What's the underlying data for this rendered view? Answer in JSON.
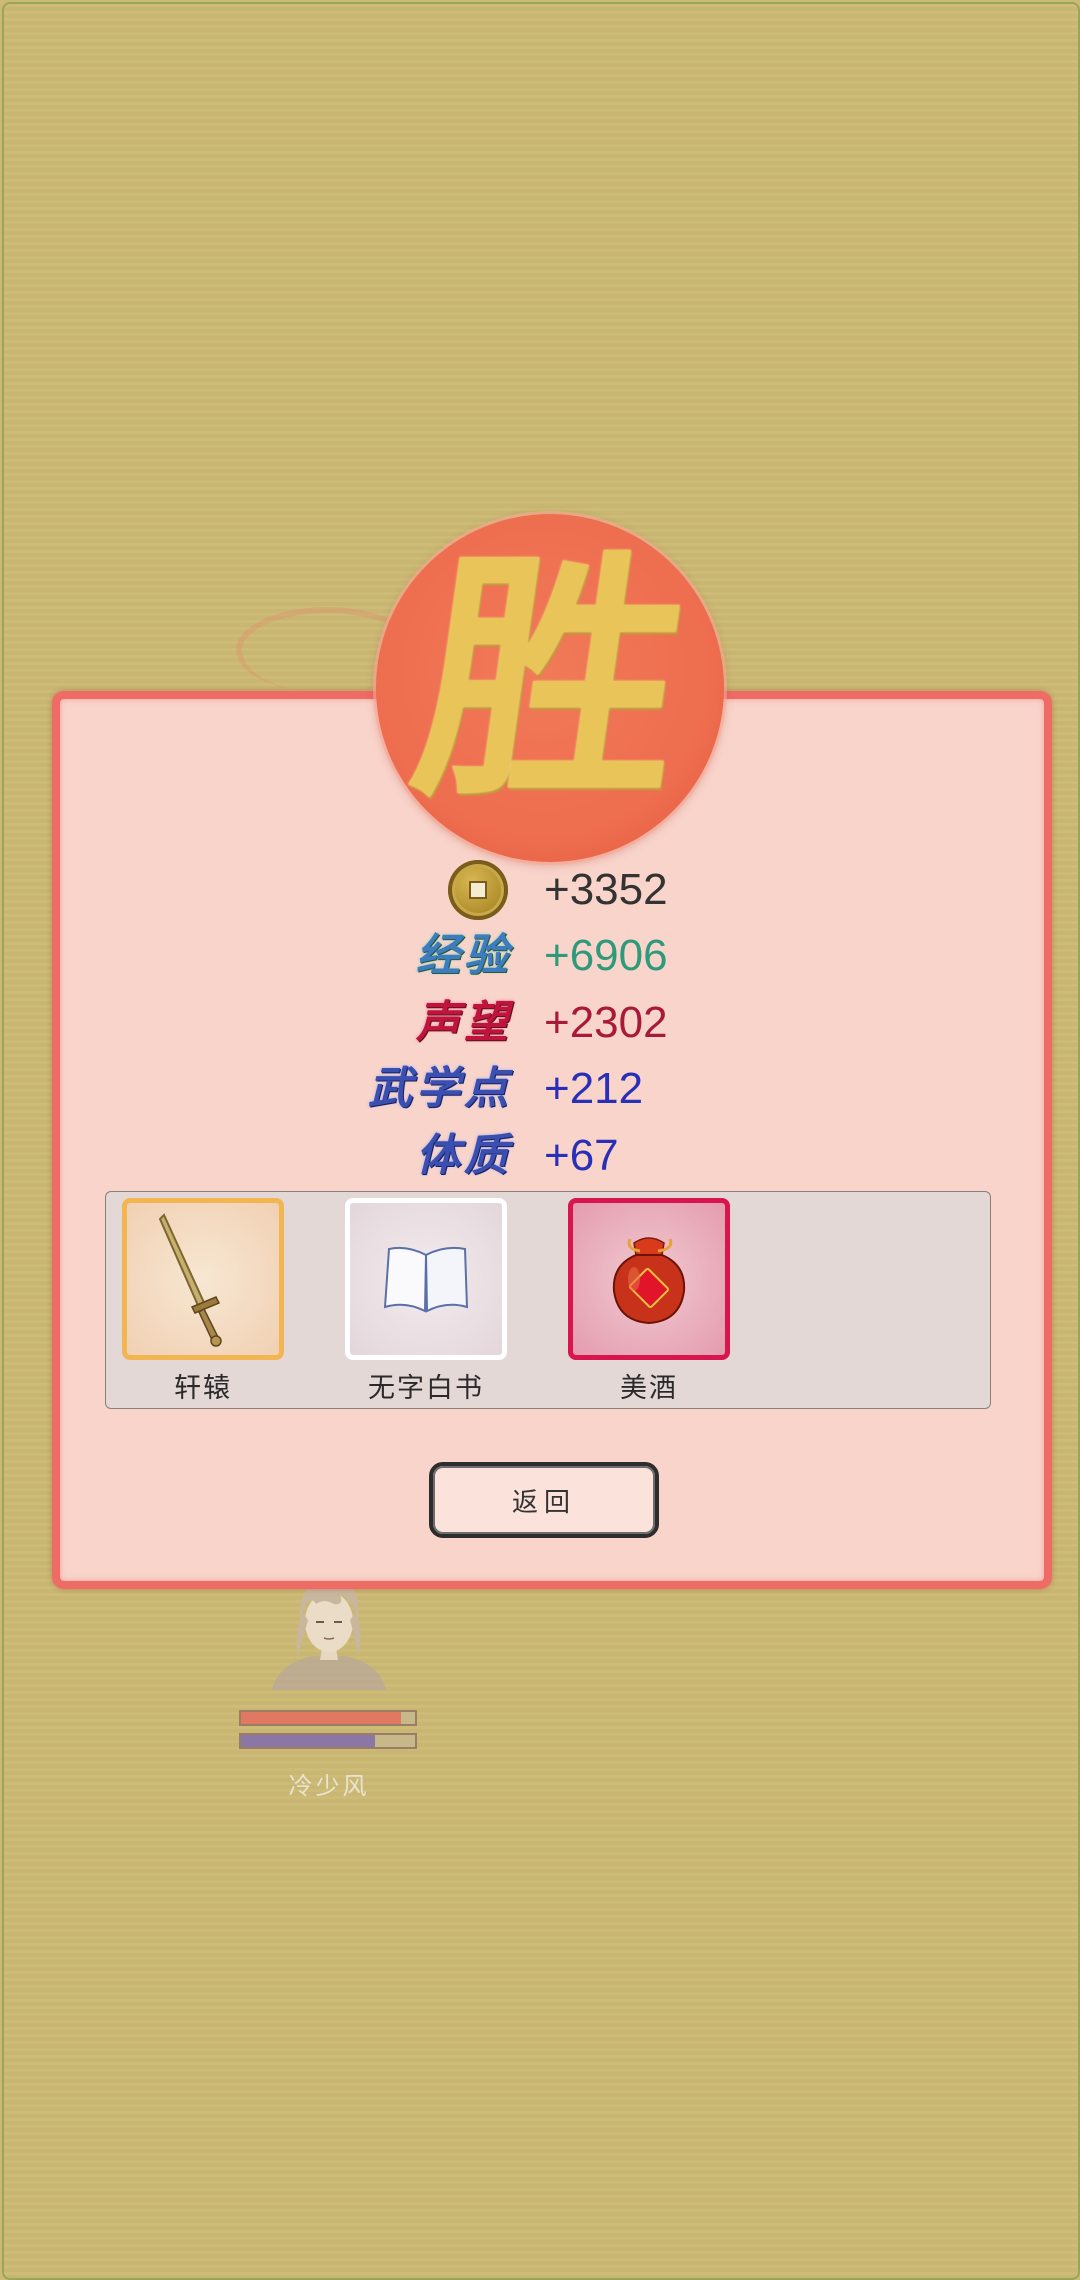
{
  "result": {
    "badge": "胜"
  },
  "rewards": [
    {
      "icon": "coin-icon",
      "label": "",
      "value": "+3352",
      "color": "#333333"
    },
    {
      "label": "经验",
      "value": "+6906",
      "color": "#2e9a7a",
      "label_color": "#3e7cc0"
    },
    {
      "label": "声望",
      "value": "+2302",
      "color": "#a81a3a",
      "label_color": "#c0143c"
    },
    {
      "label": "武学点",
      "value": "+212",
      "color": "#2a2fb8",
      "label_color": "#3a4fb0"
    },
    {
      "label": "体质",
      "value": "+67",
      "color": "#2a2fb8",
      "label_color": "#3a4fb0"
    }
  ],
  "items": [
    {
      "name": "轩辕",
      "icon": "sword-icon",
      "rarity_color": "#f2b551"
    },
    {
      "name": "无字白书",
      "icon": "book-icon",
      "rarity_color": "#ffffff"
    },
    {
      "name": "美酒",
      "icon": "wine-jar-icon",
      "rarity_color": "#d9144e"
    }
  ],
  "buttons": {
    "return_label": "返回"
  },
  "character": {
    "name": "冷少风",
    "hp_fraction": 0.92,
    "mp_fraction": 0.77
  }
}
